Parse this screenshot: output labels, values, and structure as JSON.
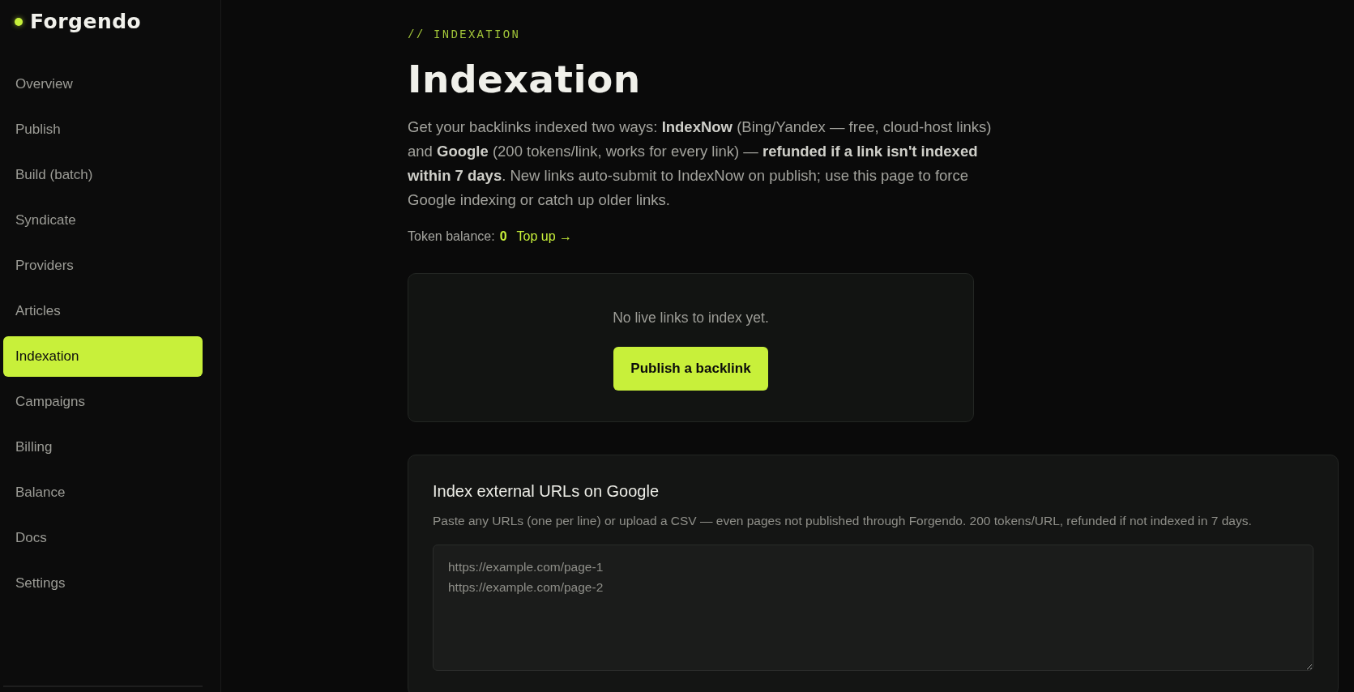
{
  "sidebar": {
    "brand": "Forgendo",
    "items": [
      {
        "label": "Overview",
        "selected": false
      },
      {
        "label": "Publish",
        "selected": false
      },
      {
        "label": "Build (batch)",
        "selected": false
      },
      {
        "label": "Syndicate",
        "selected": false
      },
      {
        "label": "Providers",
        "selected": false
      },
      {
        "label": "Articles",
        "selected": false
      },
      {
        "label": "Indexation",
        "selected": true
      },
      {
        "label": "Campaigns",
        "selected": false
      },
      {
        "label": "Billing",
        "selected": false
      },
      {
        "label": "Balance",
        "selected": false
      },
      {
        "label": "Docs",
        "selected": false
      },
      {
        "label": "Settings",
        "selected": false
      }
    ]
  },
  "header": {
    "eyebrow": "// INDEXATION",
    "title": "Indexation",
    "intro": "Get your backlinks indexed two ways: **IndexNow** (Bing/Yandex — free, cloud-host links) and **Google** (200 tokens/link, works for every link) — **refunded if a link isn't indexed within 7 days**. New links auto-submit to IndexNow on publish; use this page to force Google indexing or catch up older links."
  },
  "token_balance": {
    "label": "Token balance:",
    "value": "0",
    "link": "Top up →"
  },
  "empty_state": {
    "message": "No live links to index yet.",
    "button": "Publish a backlink"
  },
  "external_index": {
    "title": "Index external URLs on Google",
    "description": "Paste any URLs (one per line) or upload a CSV — even pages not published through Forgendo. 200 tokens/URL, refunded if not indexed in 7 days.",
    "urls_field": {
      "placeholder": "https://example.com/page-1\nhttps://example.com/page-2"
    }
  }
}
